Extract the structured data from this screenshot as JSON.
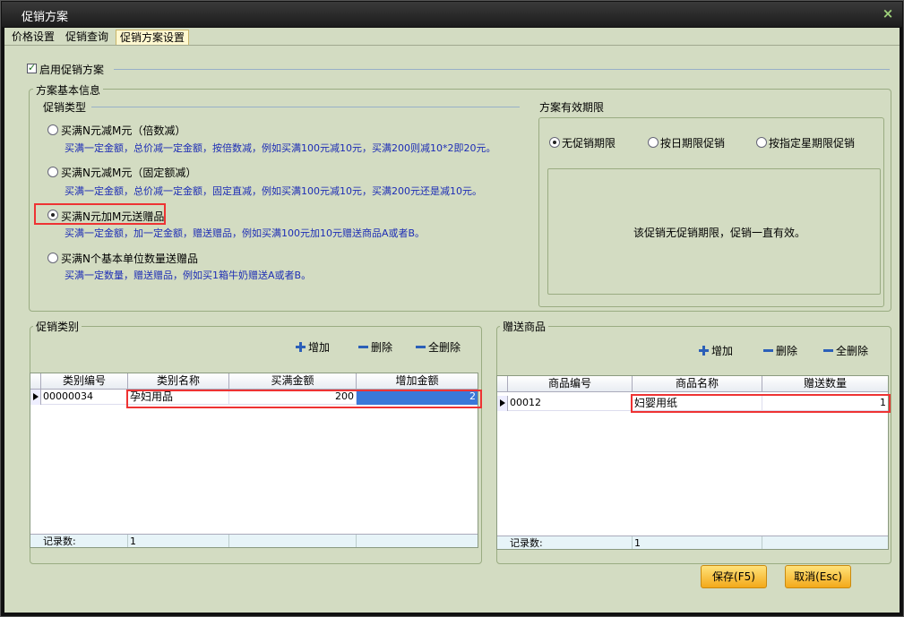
{
  "window": {
    "title": "促销方案",
    "close_label": "×"
  },
  "tabs": [
    "价格设置",
    "促销查询",
    "促销方案设置"
  ],
  "enable_promo": {
    "label": "启用促销方案",
    "checked": true
  },
  "basic_info": {
    "title": "方案基本信息"
  },
  "promo_type": {
    "title": "促销类型",
    "options": [
      {
        "label": "买满N元减M元（倍数减）",
        "desc": "买满一定金额，总价减一定金额，按倍数减，例如买满100元减10元，买满200则减10*2即20元。",
        "selected": false
      },
      {
        "label": "买满N元减M元（固定额减）",
        "desc": "买满一定金额，总价减一定金额，固定直减，例如买满100元减10元，买满200元还是减10元。",
        "selected": false
      },
      {
        "label": "买满N元加M元送赠品",
        "desc": "买满一定金额，加一定金额，赠送赠品，例如买满100元加10元赠送商品A或者B。",
        "selected": true
      },
      {
        "label": "买满N个基本单位数量送赠品",
        "desc": "买满一定数量，赠送赠品，例如买1箱牛奶赠送A或者B。",
        "selected": false
      }
    ]
  },
  "validity": {
    "title": "方案有效期限",
    "options": [
      {
        "label": "无促销期限",
        "selected": true
      },
      {
        "label": "按日期限促销",
        "selected": false
      },
      {
        "label": "按指定星期限促销",
        "selected": false
      }
    ],
    "message": "该促销无促销期限，促销一直有效。"
  },
  "category": {
    "title": "促销类别",
    "toolbar": {
      "add": "增加",
      "delete": "删除",
      "delete_all": "全删除"
    },
    "columns": [
      "类别编号",
      "类别名称",
      "买满金额",
      "增加金额"
    ],
    "rows": [
      {
        "code": "00000034",
        "name": "孕妇用品",
        "amount": "200",
        "add_amount": "2"
      }
    ],
    "footer_label": "记录数:",
    "record_count": "1"
  },
  "gift": {
    "title": "赠送商品",
    "toolbar": {
      "add": "增加",
      "delete": "删除",
      "delete_all": "全删除"
    },
    "columns": [
      "商品编号",
      "商品名称",
      "赠送数量"
    ],
    "rows": [
      {
        "code": "00012",
        "name": "妇婴用纸",
        "qty": "1"
      }
    ],
    "footer_label": "记录数:",
    "record_count": "1"
  },
  "buttons": {
    "save": "保存(F5)",
    "cancel": "取消(Esc)"
  },
  "colors": {
    "background": "#d3dcc2",
    "desc_text": "#1d2db5",
    "highlight": "#ee3333",
    "button": "#f3a91a"
  }
}
